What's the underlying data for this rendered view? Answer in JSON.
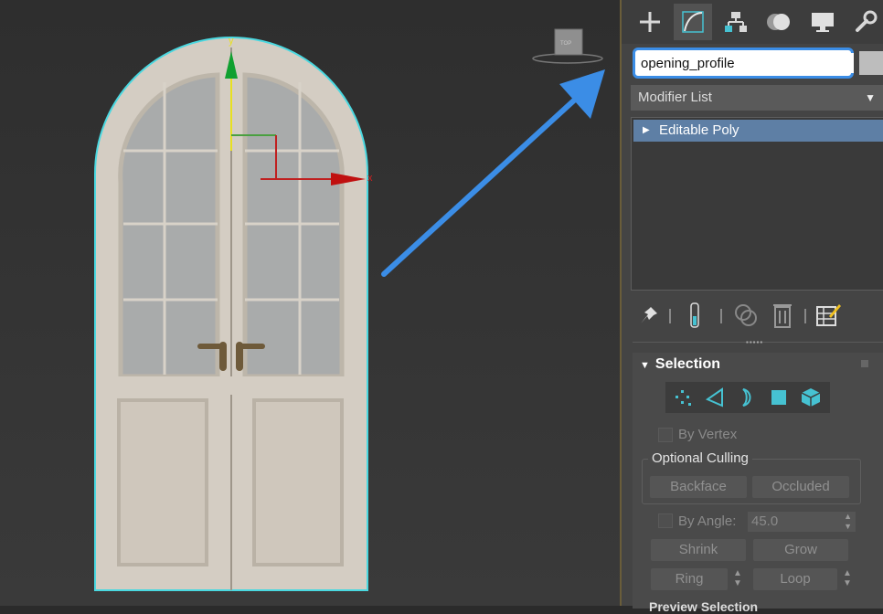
{
  "viewport": {
    "axis_y_label": "y",
    "axis_x_label": "x",
    "viewcube_label": "TOP"
  },
  "command_panel": {
    "tabs": [
      {
        "icon": "plus-icon",
        "name": "create"
      },
      {
        "icon": "modify-curve-icon",
        "name": "modify"
      },
      {
        "icon": "hierarchy-icon",
        "name": "hierarchy"
      },
      {
        "icon": "motion-icon",
        "name": "motion"
      },
      {
        "icon": "display-monitor-icon",
        "name": "display"
      },
      {
        "icon": "wrench-icon",
        "name": "utilities"
      }
    ],
    "object_name": "opening_profile",
    "object_color": "#bdbdbd",
    "modifier_list_label": "Modifier List",
    "stack_items": [
      "Editable Poly"
    ]
  },
  "selection_rollout": {
    "title": "Selection",
    "by_vertex_label": "By Vertex",
    "optional_culling_label": "Optional Culling",
    "backface_label": "Backface",
    "occluded_label": "Occluded",
    "by_angle_label": "By Angle:",
    "by_angle_value": "45.0",
    "shrink_label": "Shrink",
    "grow_label": "Grow",
    "ring_label": "Ring",
    "loop_label": "Loop",
    "preview_selection_label": "Preview Selection"
  },
  "colors": {
    "highlight_blue": "#3b8de6",
    "stack_selected": "#5e7fa5",
    "selection_cyan": "#46c2d2",
    "outline_cyan": "#4ad8e0"
  }
}
